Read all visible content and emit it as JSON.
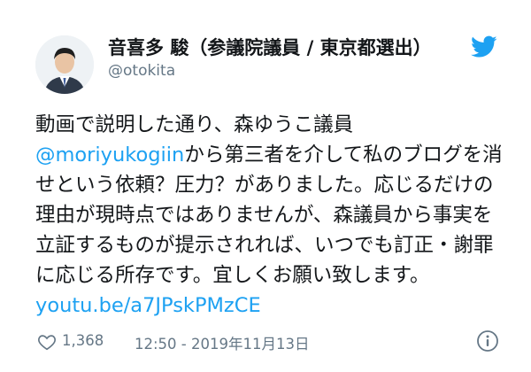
{
  "author": {
    "name": "音喜多 駿（参議院議員 / 東京都選出）",
    "handle": "@otokita"
  },
  "tweet": {
    "text_1": "動画で説明した通り、森ゆうこ議員",
    "mention": "@moriyukogiin",
    "text_2": "から第三者を介して私のブログを消せという依頼？圧力？がありました。応じるだけの理由が現時点ではありませんが、森議員から事実を立証するものが提示されれば、いつでも訂正・謝罪に応じる所存です。宜しくお願い致します。",
    "link": "youtu.be/a7JPskPMzCE"
  },
  "footer": {
    "like_count": "1,368",
    "timestamp": "12:50 - 2019年11月13日"
  },
  "icons": {
    "brand": "twitter-bird-icon",
    "like": "heart-icon",
    "info": "info-icon"
  },
  "colors": {
    "accent": "#1da1f2",
    "text": "#14171a",
    "secondary": "#657786"
  }
}
